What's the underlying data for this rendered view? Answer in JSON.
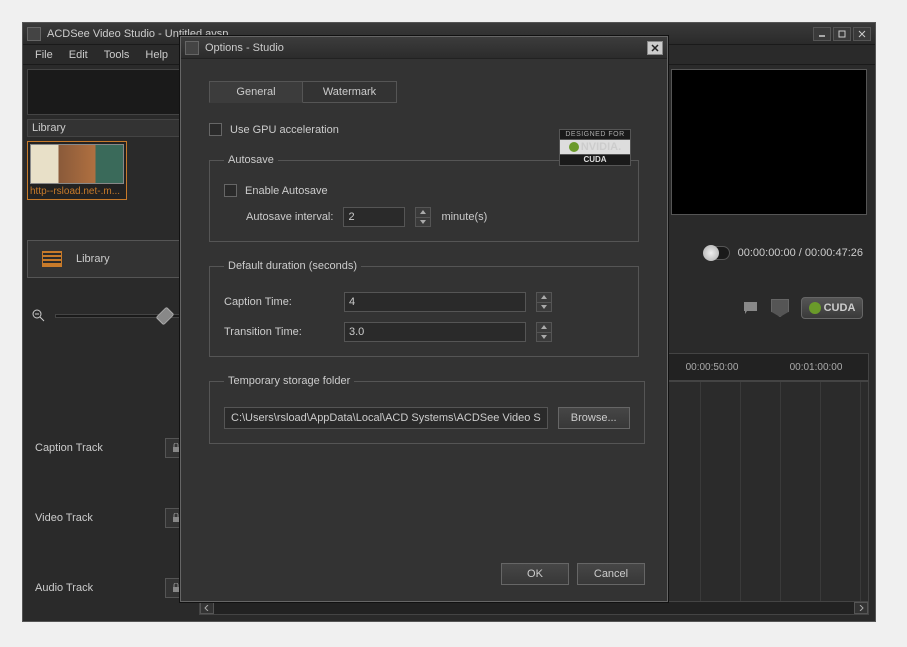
{
  "window": {
    "title": "ACDSee Video Studio - Untitled.avsp"
  },
  "menu": {
    "file": "File",
    "edit": "Edit",
    "tools": "Tools",
    "help": "Help"
  },
  "library": {
    "header": "Library",
    "thumb_caption": "http--rsload.net-.m...",
    "tab_label": "Library"
  },
  "tracks": {
    "caption": "Caption Track",
    "video": "Video Track",
    "audio": "Audio Track"
  },
  "playback": {
    "time": "00:00:00:00 / 00:00:47:26",
    "cuda": "CUDA"
  },
  "timeline": {
    "t1": "00:00:50:00",
    "t2": "00:01:00:00"
  },
  "dialog": {
    "title": "Options - Studio",
    "tabs": {
      "general": "General",
      "watermark": "Watermark"
    },
    "gpu_label": "Use GPU acceleration",
    "nvidia_top": "DESIGNED FOR",
    "nvidia_mid": "NVIDIA.",
    "nvidia_bot": "CUDA",
    "autosave": {
      "legend": "Autosave",
      "enable": "Enable Autosave",
      "interval_label": "Autosave interval:",
      "interval_value": "2",
      "interval_unit": "minute(s)"
    },
    "duration": {
      "legend": "Default duration (seconds)",
      "caption_label": "Caption Time:",
      "caption_value": "4",
      "transition_label": "Transition Time:",
      "transition_value": "3.0"
    },
    "temp": {
      "legend": "Temporary storage folder",
      "path": "C:\\Users\\rsload\\AppData\\Local\\ACD Systems\\ACDSee Video S",
      "browse": "Browse..."
    },
    "ok": "OK",
    "cancel": "Cancel"
  }
}
